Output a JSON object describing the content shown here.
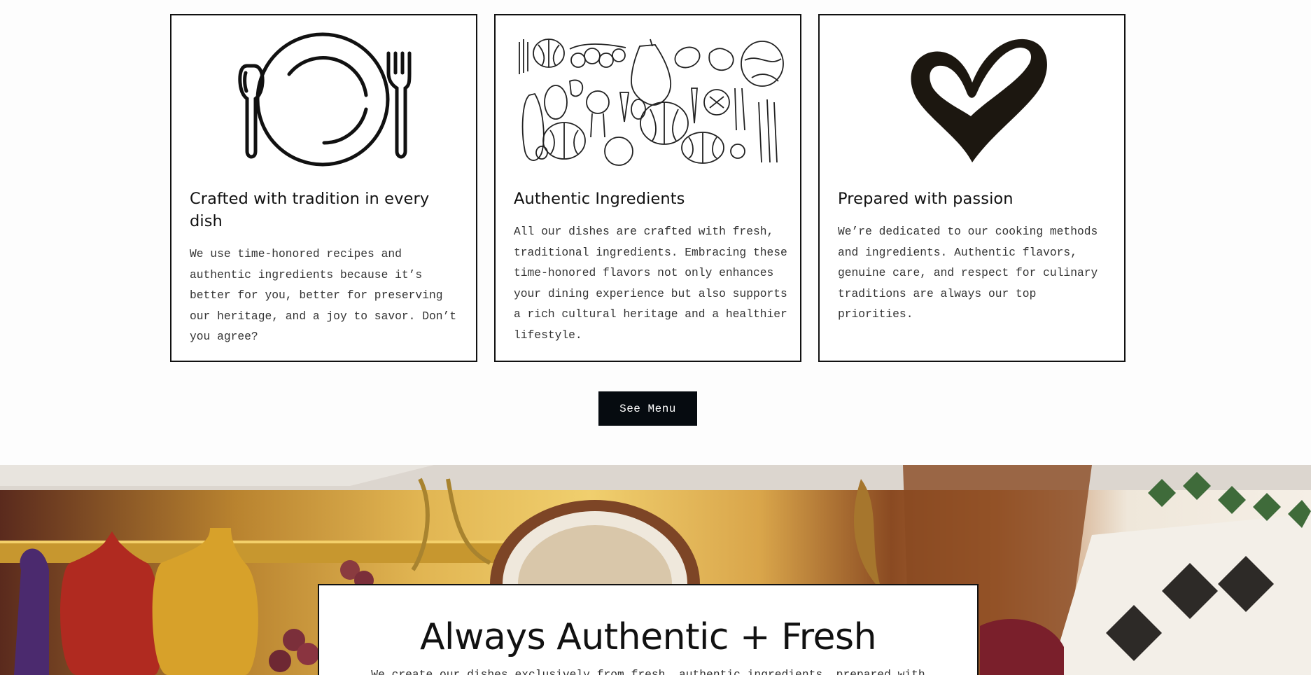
{
  "features": [
    {
      "icon": "plate-cutlery-icon",
      "title": "Crafted with tradition in every dish",
      "body": "We use time-honored recipes and authentic ingredients because it’s better for you, better for preserving our heritage, and a joy to savor. Don’t you agree?"
    },
    {
      "icon": "vegetables-illustration",
      "title": "Authentic Ingredients",
      "body": "All our dishes are crafted with fresh, traditional ingredients. Embracing these time-honored flavors not only enhances your dining experience but also supports a rich cultural heritage and a healthier lifestyle."
    },
    {
      "icon": "heart-icon",
      "title": "Prepared with passion",
      "body": "We’re dedicated to our cooking methods and ingredients. Authentic flavors, genuine care, and respect for culinary traditions are always our top priorities."
    }
  ],
  "cta": {
    "label": "See Menu"
  },
  "banner": {
    "heading": "Always Authentic + Fresh",
    "subtext": "We create our dishes exclusively from fresh, authentic ingredients, prepared with"
  },
  "colors": {
    "button_bg": "#060b10",
    "border": "#111111",
    "page_bg": "#fdfdfd"
  }
}
